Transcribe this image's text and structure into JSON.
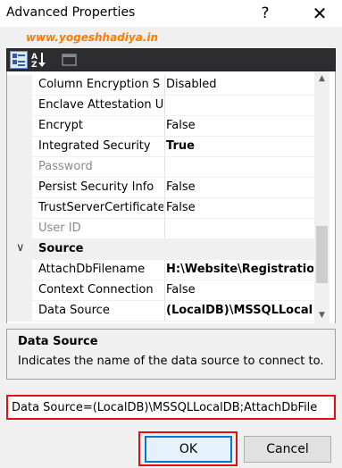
{
  "window": {
    "title": "Advanced Properties",
    "help": "?",
    "close": "✕"
  },
  "watermark": "www.yogeshhadiya.in",
  "toolbar": {
    "buttons": [
      "categorized",
      "alphabetical",
      "property-pages"
    ]
  },
  "properties": {
    "rows": [
      {
        "name": "Column Encryption S",
        "value": "Disabled"
      },
      {
        "name": "Enclave Attestation U",
        "value": ""
      },
      {
        "name": "Encrypt",
        "value": "False"
      },
      {
        "name": "Integrated Security",
        "value": "True"
      },
      {
        "name": "Password",
        "value": ""
      },
      {
        "name": "Persist Security Info",
        "value": "False"
      },
      {
        "name": "TrustServerCertificate",
        "value": "False"
      },
      {
        "name": "User ID",
        "value": ""
      }
    ],
    "category": {
      "name": "Source",
      "chevron": "∨"
    },
    "source_rows": [
      {
        "name": "AttachDbFilename",
        "value": "H:\\Website\\Registration"
      },
      {
        "name": "Context Connection",
        "value": "False"
      },
      {
        "name": "Data Source",
        "value": "(LocalDB)\\MSSQLLocalD"
      }
    ]
  },
  "description": {
    "title": "Data Source",
    "text": "Indicates the name of the data source to connect to."
  },
  "connection_string": "Data Source=(LocalDB)\\MSSQLLocalDB;AttachDbFile",
  "buttons": {
    "ok": "OK",
    "cancel": "Cancel"
  },
  "colors": {
    "highlight": "#e01010",
    "watermark": "#ff7a00",
    "focus": "#0078d7"
  }
}
